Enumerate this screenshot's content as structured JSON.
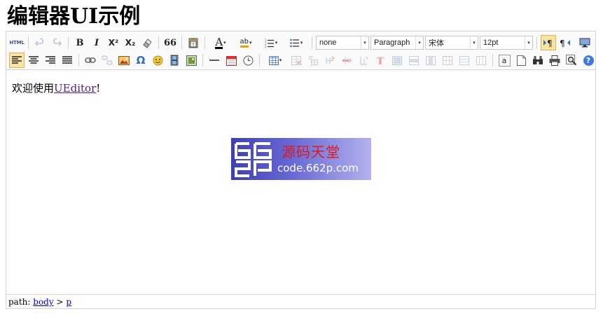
{
  "page": {
    "title": "编辑器UI示例"
  },
  "toolbar": {
    "html_label": "HTML",
    "bold": "B",
    "italic": "I",
    "superscript": "X²",
    "subscript": "X₂",
    "quote": "66",
    "font_color": "A",
    "highlight": "ab",
    "omega": "Ω",
    "amazon": "a",
    "help": "?",
    "font_family": "none",
    "paragraph": "Paragraph",
    "font_face": "宋体",
    "font_size": "12pt",
    "arrow_glyph": "▾",
    "colors": {
      "accent": "#2a6fc9",
      "active_bg": "#fbe3a5",
      "disabled": "#b8c7d8"
    }
  },
  "content": {
    "text_before": "欢迎使用",
    "link_text": "UEditor",
    "text_after": "!",
    "watermark": {
      "cn_text": "源码天堂",
      "en_text": "code.662p.com",
      "logo_text": "662P"
    }
  },
  "statusbar": {
    "prefix": "path:",
    "body": "body",
    "sep": ">",
    "p": "p"
  }
}
